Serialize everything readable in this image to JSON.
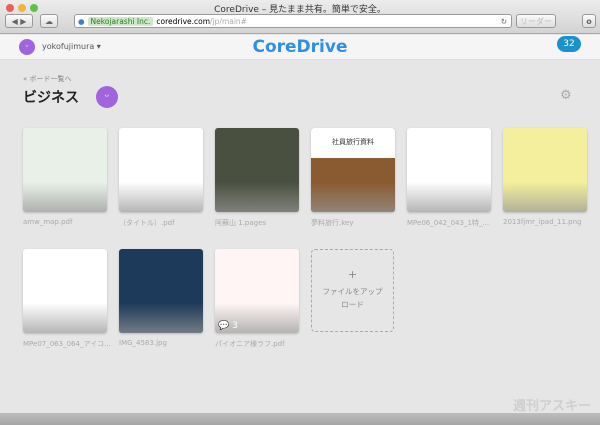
{
  "window": {
    "title": "CoreDrive – 見たまま共有。簡単で安全。",
    "secure_label": "Nekojarashi Inc.",
    "url_host": "coredrive.com",
    "url_path": "/jp/main#",
    "reader_label": "リーダー"
  },
  "header": {
    "username": "yokofujimura",
    "logo": "CoreDrive",
    "notification_count": "32"
  },
  "board": {
    "back_link": "« ボード一覧へ",
    "title": "ビジネス"
  },
  "files": [
    {
      "name": "amw_map.pdf",
      "color": "#e8f0e8"
    },
    {
      "name": "（タイトル）.pdf",
      "color": "#ffffff"
    },
    {
      "name": "阿蘇山 1.pages",
      "color": "#4a5040"
    },
    {
      "name": "夢料旅行.key",
      "color": "#8a5a30",
      "title": "社員旅行資料"
    },
    {
      "name": "MPe06_042_043_1特_...",
      "color": "#ffffff"
    },
    {
      "name": "2013fjmr_ipad_11.png",
      "color": "#f3ef9c"
    },
    {
      "name": "MPe07_063_064_アイコ...",
      "color": "#ffffff"
    },
    {
      "name": "IMG_4583.jpg",
      "color": "#1e3a5a"
    },
    {
      "name": "パイオニア様ラフ.pdf",
      "color": "#fff5f5",
      "comments": "3"
    }
  ],
  "upload": {
    "plus": "+",
    "label": "ファイルをアップロード"
  },
  "watermark": "週刊アスキー"
}
